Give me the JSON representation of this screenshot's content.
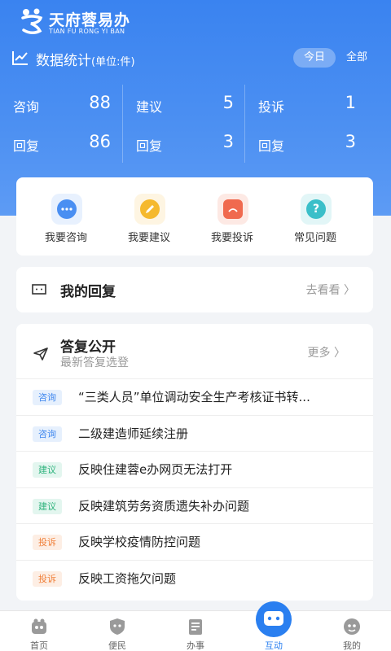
{
  "brand": {
    "title": "天府蓉易办",
    "subtitle": "TIAN FU RONG YI BAN",
    "color": "#3a83f0"
  },
  "stats": {
    "title": "数据统计",
    "unit": "(单位:件)",
    "period_today": "今日",
    "period_all": "全部",
    "columns": [
      {
        "label": "咨询",
        "value": "88",
        "reply_label": "回复",
        "reply_value": "86"
      },
      {
        "label": "建议",
        "value": "5",
        "reply_label": "回复",
        "reply_value": "3"
      },
      {
        "label": "投诉",
        "value": "1",
        "reply_label": "回复",
        "reply_value": "3"
      }
    ]
  },
  "actions": [
    {
      "label": "我要咨询",
      "icon": "chat-bubble-icon",
      "color": "#4a8ff2"
    },
    {
      "label": "我要建议",
      "icon": "pencil-icon",
      "color": "#f5b92e"
    },
    {
      "label": "我要投诉",
      "icon": "complaint-bubble-icon",
      "color": "#f06a4f"
    },
    {
      "label": "常见问题",
      "icon": "question-icon",
      "color": "#3bbfc9"
    }
  ],
  "my_reply": {
    "title": "我的回复",
    "link": "去看看 〉"
  },
  "public_answers": {
    "title": "答复公开",
    "subtitle": "最新答复选登",
    "more": "更多 〉",
    "items": [
      {
        "tag": "咨询",
        "tag_type": "consult",
        "text": "“三类人员”单位调动安全生产考核证书转..."
      },
      {
        "tag": "咨询",
        "tag_type": "consult",
        "text": "二级建造师延续注册"
      },
      {
        "tag": "建议",
        "tag_type": "suggest",
        "text": "反映住建蓉e办网页无法打开"
      },
      {
        "tag": "建议",
        "tag_type": "suggest",
        "text": "反映建筑劳务资质遗失补办问题"
      },
      {
        "tag": "投诉",
        "tag_type": "complain",
        "text": "反映学校疫情防控问题"
      },
      {
        "tag": "投诉",
        "tag_type": "complain",
        "text": "反映工资拖欠问题"
      }
    ],
    "tag_colors": {
      "consult": {
        "bg": "#e6f0fd",
        "fg": "#3d86ee"
      },
      "suggest": {
        "bg": "#e3f6ef",
        "fg": "#2fb37d"
      },
      "complain": {
        "bg": "#fdeee4",
        "fg": "#f0803a"
      }
    }
  },
  "tabbar": {
    "tabs": [
      {
        "label": "首页",
        "icon": "home-icon"
      },
      {
        "label": "便民",
        "icon": "shield-icon"
      },
      {
        "label": "办事",
        "icon": "document-icon"
      },
      {
        "label": "互动",
        "icon": "interact-icon",
        "active": true
      },
      {
        "label": "我的",
        "icon": "user-icon"
      }
    ],
    "active_color": "#2a7ff0"
  }
}
